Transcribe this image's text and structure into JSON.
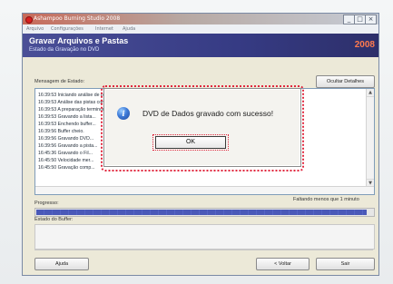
{
  "window": {
    "title": "Ashampoo Burning Studio 2008",
    "controls": [
      "_",
      "□",
      "×"
    ]
  },
  "menu": [
    "Arquivo",
    "Configurações",
    "Internet",
    "Ajuda"
  ],
  "header": {
    "title": "Gravar Arquivos e Pastas",
    "subtitle": "Estado da Gravação no DVD",
    "version": "2008"
  },
  "status": {
    "label": "Mensagem de Estado:",
    "toggle_button": "Ocultar Detalhes",
    "lines": [
      "16:39:53 Iniciando análise de pistas",
      "16:39:53 Análise das pistas completada com sucesso!",
      "16:39:53 A preparação terminou! Iniciando gravação...",
      "16:39:53 Gravando a lista...",
      "16:39:53 Enchendo buffer...",
      "16:39:56 Buffer cheio.",
      "16:39:56 Gravando DVD...",
      "16:39:56 Gravando a pista...",
      "16:45:36 Gravando o Fil...",
      "16:45:50 Velocidade mer...",
      "16:45:50 Gravação comp..."
    ]
  },
  "progress": {
    "label": "Progresso:",
    "remaining": "Faltando menos que 1 minuto",
    "fraction": 0.98
  },
  "buffer": {
    "label": "Estado do Buffer:"
  },
  "footer": {
    "help": "Ajuda",
    "back": "< Voltar",
    "exit": "Sair"
  },
  "dialog": {
    "message": "DVD de Dados gravado com sucesso!",
    "ok": "OK"
  },
  "colors": {
    "header_bg": "#3c4190",
    "progress": "#4b59ba",
    "highlight": "#e0283e"
  },
  "icons": {
    "dialog": "info-icon",
    "app": "app-icon"
  }
}
